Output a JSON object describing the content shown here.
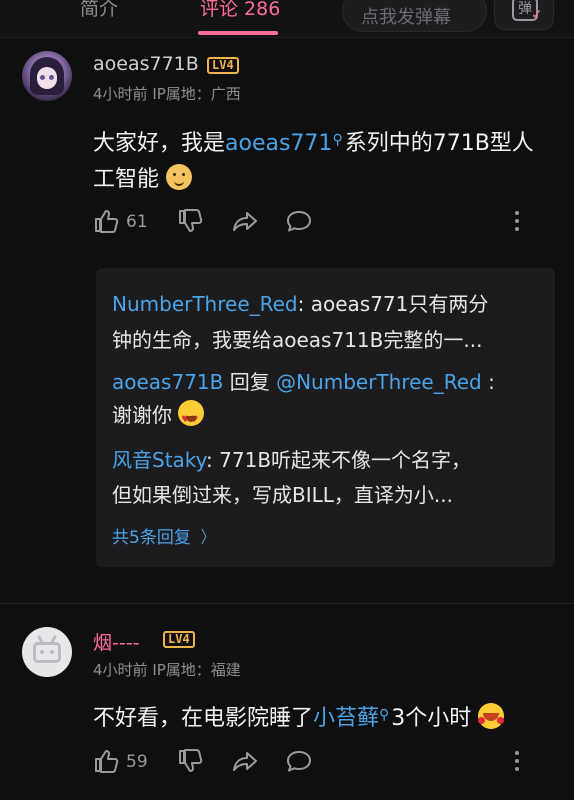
{
  "tabs": {
    "intro": "简介",
    "comments": "评论 286"
  },
  "danmaku": {
    "placeholder": "点我发弹幕",
    "button_icon_text": "弹"
  },
  "comments": [
    {
      "username": "aoeas771B",
      "level": "LV4",
      "time": "4小时前",
      "ip": "IP属地：广西",
      "text_before": "大家好，我是",
      "link": "aoeas771",
      "text_after": "系列中的771B型人工智能",
      "emoji": "doge-emoji",
      "likes": "61",
      "replies": [
        {
          "name": "NumberThree_Red",
          "text_line1": ": aoeas771只有两分",
          "text_line2": "钟的生命，我要给aoeas711B完整的一..."
        },
        {
          "name": "aoeas771B",
          "mid": " 回复 ",
          "target": "@NumberThree_Red",
          "text_line1": " :",
          "text_line2": "谢谢你"
        },
        {
          "name": "风音Staky",
          "text_line1": ": 771B听起来不像一个名字，",
          "text_line2": "但如果倒过来，写成BILL，直译为小..."
        }
      ],
      "see_more": "共5条回复"
    },
    {
      "username": "烟----",
      "level": "LV4",
      "time": "4小时前",
      "ip": "IP属地：福建",
      "text_before": "不好看，在电影院睡了",
      "link": "小苔藓",
      "text_after": "3个小时",
      "emoji": "laughing-emoji",
      "likes": "59"
    }
  ],
  "colors": {
    "accent": "#ff6f9a",
    "link": "#4aa3e8",
    "level": "#f0b24a",
    "background": "#0f0f10"
  }
}
